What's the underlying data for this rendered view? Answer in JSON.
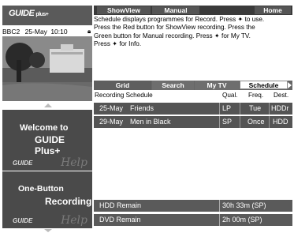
{
  "logo": {
    "text": "GUIDE",
    "plus": "plus+"
  },
  "status": {
    "channel": "BBC2",
    "date": "25-May",
    "time": "10:10"
  },
  "header": {
    "showview": "ShowView",
    "manual": "Manual",
    "home": "Home"
  },
  "info": {
    "line1": "Schedule displays programmes for Record. Press ✦ to use.",
    "line2": "Press the Red button for ShowView recording. Press the",
    "line3": "Green button for Manual recording. Press ✦ for My TV.",
    "line4": "Press ✦ for Info."
  },
  "tabs": {
    "grid": "Grid",
    "search": "Search",
    "mytv": "My TV",
    "schedule": "Schedule"
  },
  "schedule": {
    "title": "Recording Schedule",
    "col_qual": "Qual.",
    "col_freq": "Freq.",
    "col_dest": "Dest.",
    "rows": [
      {
        "date": "25-May",
        "title": "Friends",
        "qual": "LP",
        "freq": "Tue",
        "dest": "HDDr"
      },
      {
        "date": "29-May",
        "title": "Men in Black",
        "qual": "SP",
        "freq": "Once",
        "dest": "HDD"
      }
    ]
  },
  "remain": [
    {
      "label": "HDD Remain",
      "value": "30h 33m (SP)"
    },
    {
      "label": "DVD Remain",
      "value": "2h 00m (SP)"
    }
  ],
  "panels": {
    "welcome_small": "Welcome to",
    "welcome_big": "GUIDE Plus+",
    "onebutton_1": "One-Button",
    "onebutton_2": "Recording",
    "help": "Help",
    "mini_logo": "GUIDE"
  },
  "colors": {
    "panel_bg": "#4a4a4a",
    "row_bg": "#545454",
    "header_bg": "#3a3a3a"
  }
}
